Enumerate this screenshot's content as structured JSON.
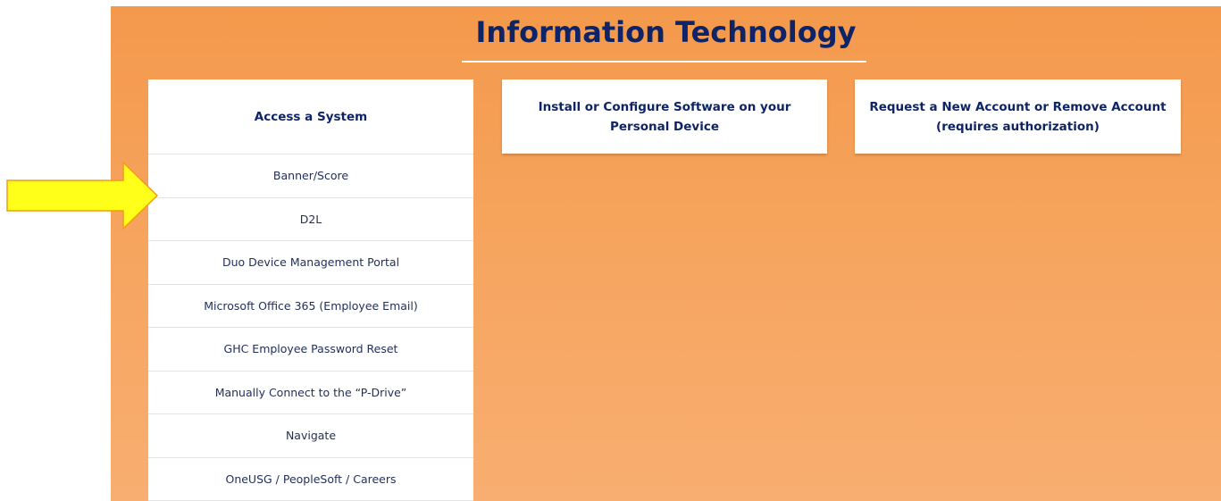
{
  "page": {
    "title": "Information Technology"
  },
  "cards": {
    "access": "Access a System",
    "install_line1": "Install or Configure Software on your",
    "install_line2": "Personal Device",
    "request_line1": "Request a New Account or Remove Account",
    "request_line2": "(requires authorization)"
  },
  "access_links": [
    "Banner/Score",
    "D2L",
    "Duo Device Management Portal",
    "Microsoft Office 365 (Employee Email)",
    "GHC Employee Password Reset",
    "Manually Connect to the “P-Drive”",
    "Navigate",
    "OneUSG / PeopleSoft / Careers"
  ],
  "colors": {
    "heading": "#0e2466",
    "panel_top": "#f4994c",
    "panel_bottom": "#f8ae71",
    "arrow_fill": "#ffff1a",
    "arrow_stroke": "#f39c12"
  },
  "icons": {
    "annotation": "right-arrow-icon"
  }
}
